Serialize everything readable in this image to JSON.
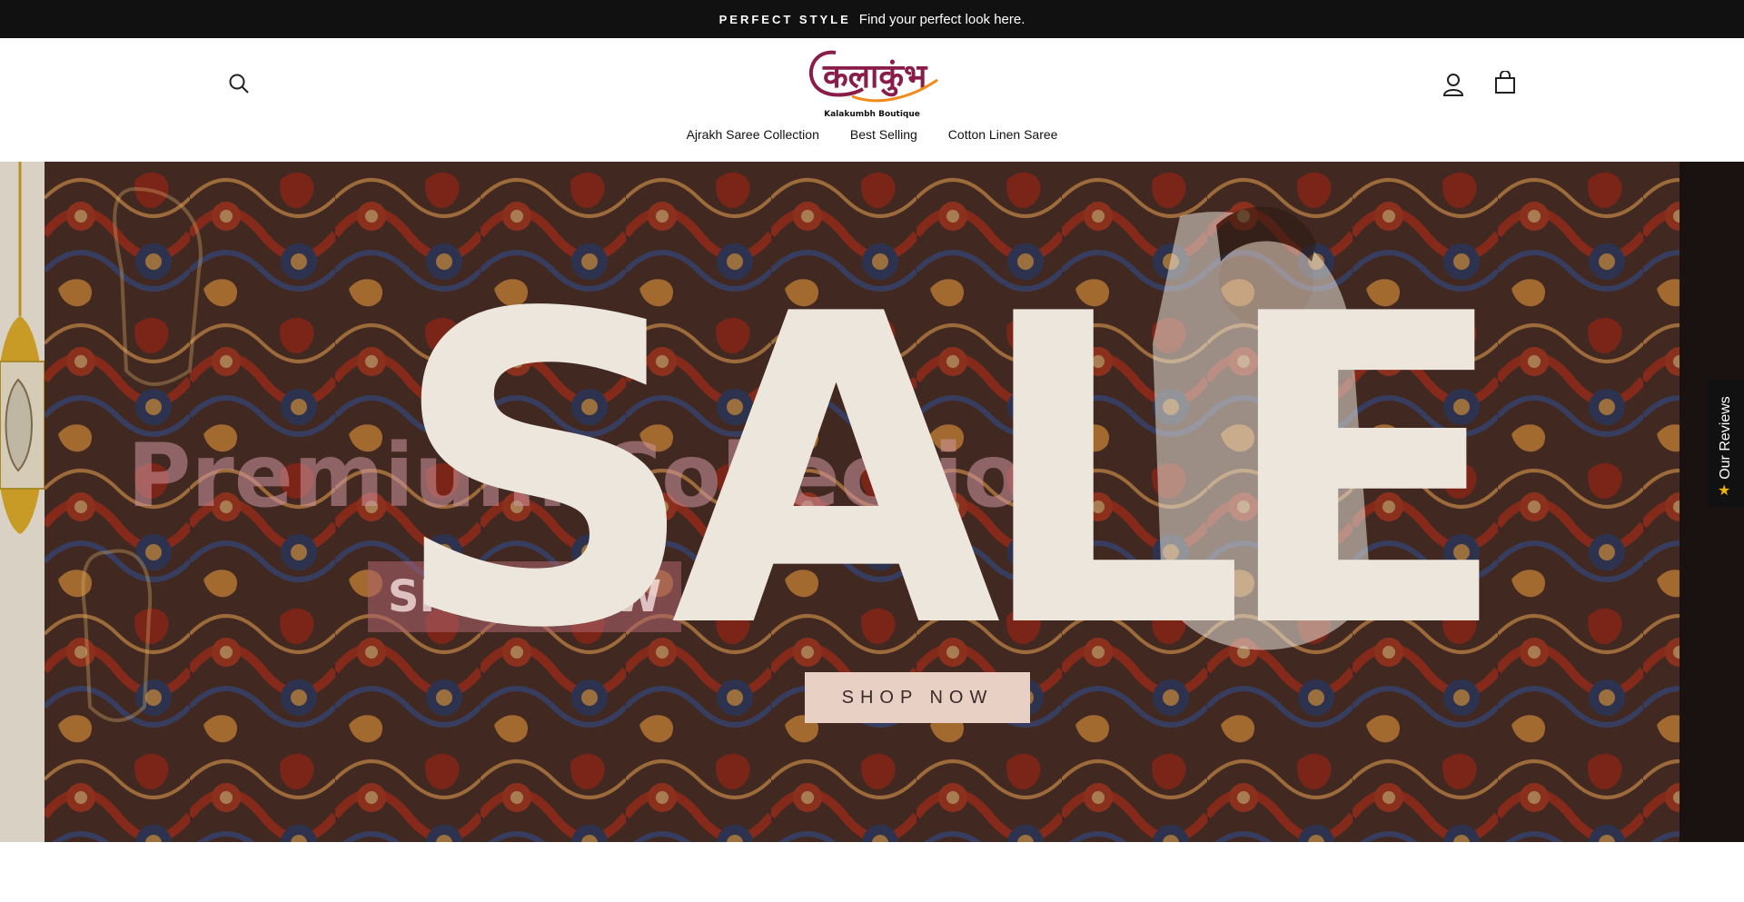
{
  "announcement": {
    "kicker": "PERFECT STYLE",
    "text": "Find your perfect look here."
  },
  "header": {
    "logo": {
      "script": "कलाकुंभ",
      "subtitle": "Kalakumbh Boutique"
    },
    "icons": {
      "search": "search-icon",
      "account": "account-icon",
      "cart": "cart-icon"
    },
    "nav": [
      "Ajrakh Saree Collection",
      "Best Selling",
      "Cotton Linen Saree"
    ]
  },
  "hero": {
    "headline": "SALE",
    "ghost_title": "Premium Collection",
    "ghost_button": "SHOP NOW",
    "cta": "SHOP NOW"
  },
  "reviews_tab": {
    "label": "Our Reviews",
    "icon": "star-icon"
  },
  "colors": {
    "announcement_bg": "#111111",
    "cta_bg": "#e8d0c4",
    "logo_maroon": "#8a1c4a",
    "logo_orange": "#f28a1a"
  }
}
